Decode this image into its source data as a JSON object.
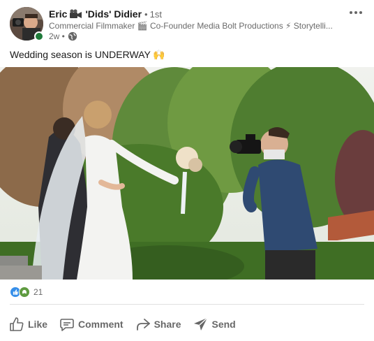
{
  "post": {
    "author": {
      "name_first": "Eric",
      "name_last": "'Dids' Didier",
      "degree_dot": "•",
      "degree": "1st",
      "headline": "Commercial Filmmaker 🎬 Co-Founder Media Bolt Productions ⚡ Storytelli...",
      "time": "2w •"
    },
    "text": "Wedding season is UNDERWAY 🙌",
    "reactions": {
      "count": "21"
    },
    "actions": {
      "like": "Like",
      "comment": "Comment",
      "share": "Share",
      "send": "Send"
    }
  },
  "colors": {
    "presence": "#1f7a3a",
    "like_reaction": "#378fe9",
    "support_reaction": "#5f9b41",
    "action_text": "#666666"
  },
  "icons": {
    "author_emoji": "movie-camera-icon",
    "visibility": "globe-icon",
    "menu": "more-options-icon",
    "like": "thumbs-up-icon",
    "comment": "comment-bubble-icon",
    "share": "share-arrow-icon",
    "send": "paper-plane-icon"
  }
}
